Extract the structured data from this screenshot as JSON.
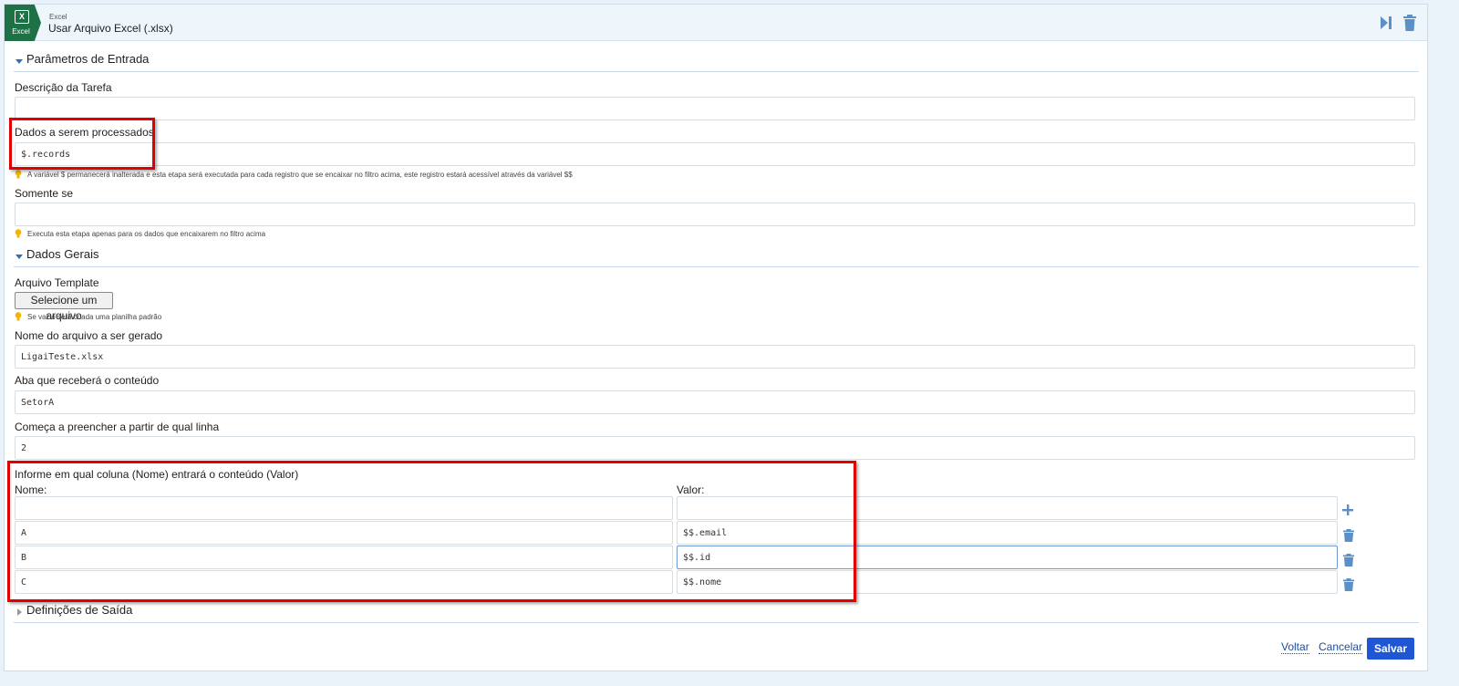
{
  "header": {
    "logo_label": "Excel",
    "subtitle": "Excel",
    "title": "Usar Arquivo Excel (.xlsx)",
    "run_icon": "skip-forward-icon",
    "delete_icon": "trash-icon"
  },
  "input_params": {
    "section_title": "Parâmetros de Entrada",
    "task_description": {
      "label": "Descrição da Tarefa",
      "value": ""
    },
    "data_to_process": {
      "label": "Dados a serem processados",
      "value": "$.records",
      "hint": "A variável $ permanecerá inalterada e esta etapa será executada para cada registro que se encaixar no filtro acima, este registro estará acessível através da variável $$"
    },
    "only_if": {
      "label": "Somente se",
      "value": "",
      "hint": "Executa esta etapa apenas para os dados que encaixarem no filtro acima"
    }
  },
  "general_data": {
    "section_title": "Dados Gerais",
    "template_file": {
      "label": "Arquivo Template",
      "button_label": "Selecione um arquivo",
      "hint": "Se vazio será criada uma planilha padrão"
    },
    "file_name": {
      "label": "Nome do arquivo a ser gerado",
      "value": "LigaiTeste.xlsx"
    },
    "sheet": {
      "label": "Aba que receberá o conteúdo",
      "value": "SetorA"
    },
    "start_row": {
      "label": "Começa a preencher a partir de qual linha",
      "value": "2"
    },
    "columns": {
      "label": "Informe em qual coluna (Nome) entrará o conteúdo (Valor)",
      "name_header": "Nome:",
      "value_header": "Valor:",
      "new_row": {
        "name": "",
        "value": ""
      },
      "rows": [
        {
          "name": "A",
          "value": "$$.email"
        },
        {
          "name": "B",
          "value": "$$.id"
        },
        {
          "name": "C",
          "value": "$$.nome"
        }
      ]
    }
  },
  "output": {
    "section_title": "Definições de Saída"
  },
  "footer": {
    "back": "Voltar",
    "cancel": "Cancelar",
    "save": "Salvar"
  },
  "colors": {
    "excel_green": "#1e7145",
    "accent_blue": "#1e56d6",
    "icon_blue": "#5b8fc7",
    "highlight_red": "#e00000"
  }
}
